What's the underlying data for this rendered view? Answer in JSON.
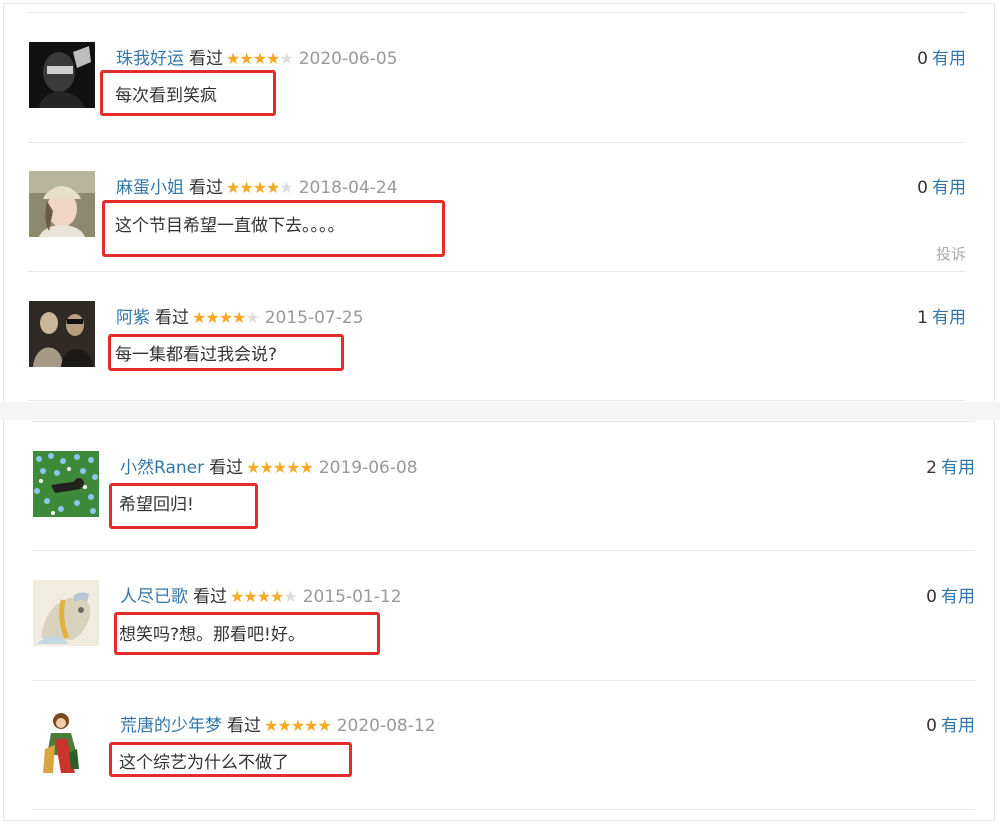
{
  "comments": [
    {
      "user": "珠我好运",
      "watched": "看过",
      "rating": 4,
      "date": "2020-06-05",
      "votes": "0",
      "useful": "有用",
      "text": "每次看到笑疯",
      "avatar": "dark-portrait-avatar"
    },
    {
      "user": "麻蛋小姐",
      "watched": "看过",
      "rating": 4,
      "date": "2018-04-24",
      "votes": "0",
      "useful": "有用",
      "text": "这个节目希望一直做下去。。。。",
      "report": "投诉",
      "avatar": "woman-in-cap-avatar"
    },
    {
      "user": "阿紫",
      "watched": "看过",
      "rating": 4,
      "date": "2015-07-25",
      "votes": "1",
      "useful": "有用",
      "text": "每一集都看过我会说?",
      "avatar": "two-people-avatar"
    },
    {
      "user": "小然Raner",
      "watched": "看过",
      "rating": 5,
      "date": "2019-06-08",
      "votes": "2",
      "useful": "有用",
      "text": "希望回归!",
      "avatar": "flower-field-avatar"
    },
    {
      "user": "人尽已歌",
      "watched": "看过",
      "rating": 4,
      "date": "2015-01-12",
      "votes": "0",
      "useful": "有用",
      "text": "想笑吗?想。那看吧!好。",
      "avatar": "painted-horse-avatar"
    },
    {
      "user": "荒唐的少年梦",
      "watched": "看过",
      "rating": 5,
      "date": "2020-08-12",
      "votes": "0",
      "useful": "有用",
      "text": "这个综艺为什么不做了",
      "avatar": "cartoon-couple-avatar"
    }
  ],
  "colors": {
    "link": "#3377aa",
    "star": "#f9a825",
    "star_off": "#dddddd",
    "highlight_box": "#e62b2b",
    "date": "#999999"
  }
}
